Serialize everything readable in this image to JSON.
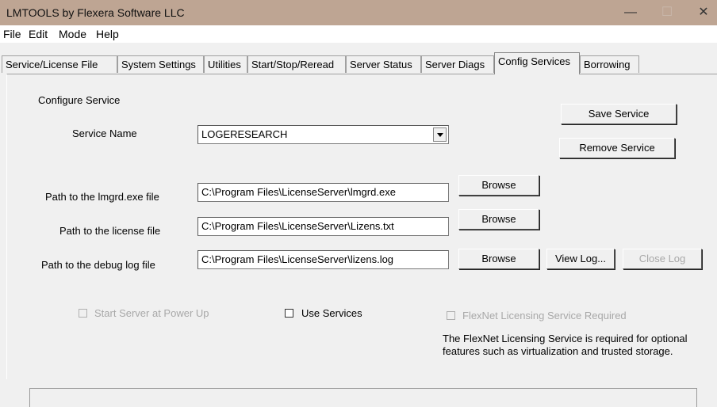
{
  "window": {
    "title": "LMTOOLS by Flexera Software LLC",
    "controls": {
      "minimize": "—",
      "maximize": "☐",
      "close": "✕"
    }
  },
  "menu": [
    "File",
    "Edit",
    "Mode",
    "Help"
  ],
  "tabs": [
    "Service/License File",
    "System Settings",
    "Utilities",
    "Start/Stop/Reread",
    "Server Status",
    "Server Diags",
    "Config Services",
    "Borrowing"
  ],
  "active_tab": "Config Services",
  "config": {
    "section_label": "Configure Service",
    "service_name_label": "Service Name",
    "service_name_value": "LOGERESEARCH",
    "save_button": "Save Service",
    "remove_button": "Remove Service",
    "lmgrd_label": "Path to the lmgrd.exe file",
    "lmgrd_value": "C:\\Program Files\\LicenseServer\\lmgrd.exe",
    "license_label": "Path to the license file",
    "license_value": "C:\\Program Files\\LicenseServer\\Lizens.txt",
    "debug_label": "Path to the debug log file",
    "debug_value": "C:\\Program Files\\LicenseServer\\lizens.log",
    "browse_label": "Browse",
    "view_log": "View Log...",
    "close_log": "Close Log",
    "start_at_power_up": "Start Server at Power Up",
    "use_services": "Use Services",
    "flexnet_required": "FlexNet Licensing Service Required",
    "flexnet_note_line1": "The FlexNet Licensing Service is required for optional",
    "flexnet_note_line2": "features such as virtualization and trusted storage."
  },
  "colors": {
    "titlebar": "#bea593",
    "window_bg": "#f0f0f0",
    "disabled_text": "#a8a8a8"
  }
}
